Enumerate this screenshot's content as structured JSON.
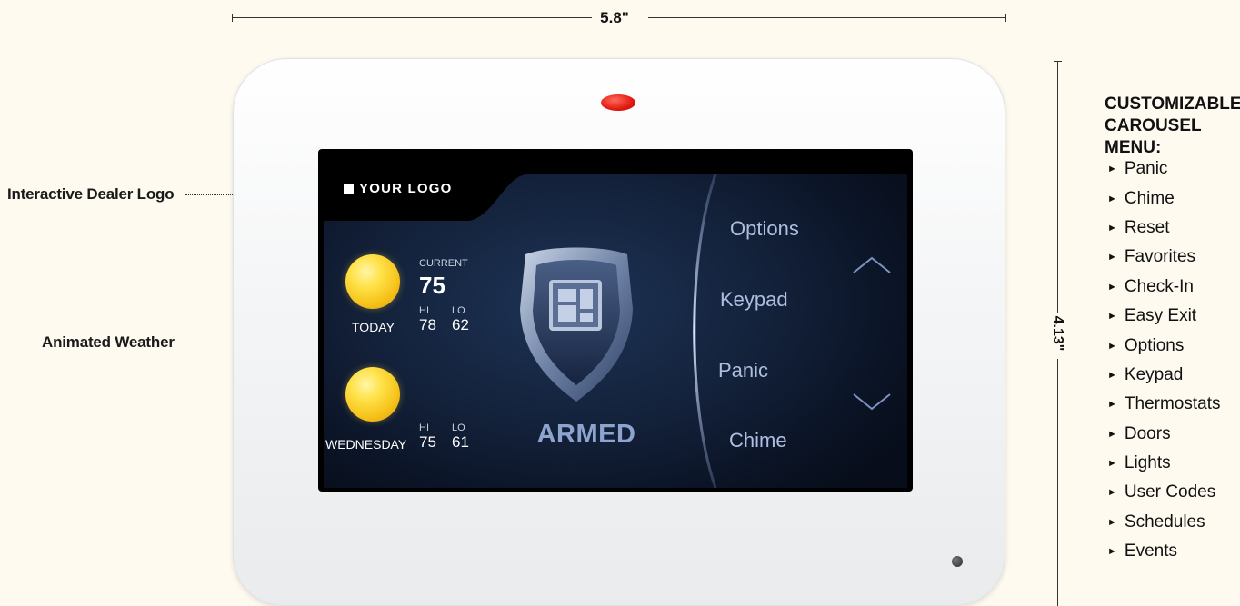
{
  "dimensions": {
    "width_label": "5.8\"",
    "height_label": "4.13\""
  },
  "callouts": {
    "logo": "Interactive Dealer Logo",
    "weather": "Animated Weather"
  },
  "screen": {
    "logo_text": "YOUR LOGO",
    "weather": {
      "today": {
        "day": "TODAY",
        "current_label": "CURRENT",
        "current": "75",
        "hi_label": "HI",
        "lo_label": "LO",
        "hi": "78",
        "lo": "62",
        "icon": "sun-icon"
      },
      "next": {
        "day": "WEDNESDAY",
        "hi_label": "HI",
        "lo_label": "LO",
        "hi": "75",
        "lo": "61",
        "icon": "sun-icon"
      }
    },
    "status": "ARMED",
    "carousel": [
      "Options",
      "Keypad",
      "Panic",
      "Chime"
    ]
  },
  "menu_list": {
    "title_line1": "CUSTOMIZABLE",
    "title_line2": "CAROUSEL MENU:",
    "items": [
      "Panic",
      "Chime",
      "Reset",
      "Favorites",
      "Check-In",
      "Easy Exit",
      "Options",
      "Keypad",
      "Thermostats",
      "Doors",
      "Lights",
      "User Codes",
      "Schedules",
      "Events"
    ]
  },
  "colors": {
    "background": "#fefaf0",
    "led": "#e11a10",
    "status_text": "#8da4cf",
    "menu_text": "#aebee0",
    "screen_bg": "#14233d"
  }
}
